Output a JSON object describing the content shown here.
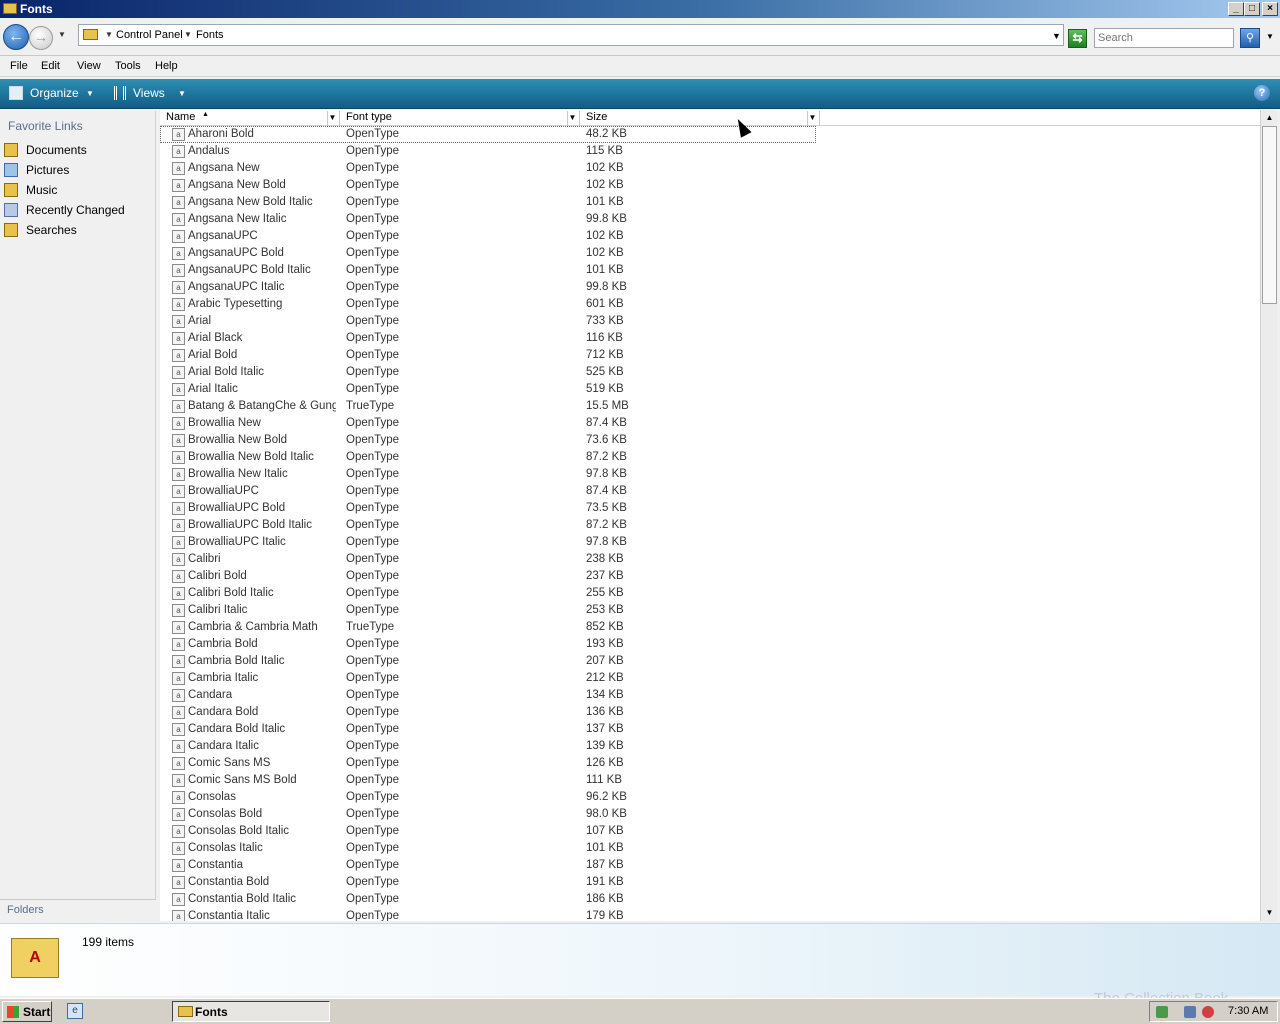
{
  "window": {
    "title": "Fonts"
  },
  "caption_buttons": {
    "minimize": "_",
    "maximize": "□",
    "close": "×"
  },
  "address": {
    "crumbs": [
      "Control Panel",
      "Fonts"
    ]
  },
  "search": {
    "placeholder": "Search"
  },
  "menu": [
    "File",
    "Edit",
    "View",
    "Tools",
    "Help"
  ],
  "commands": {
    "organize": "Organize",
    "views": "Views",
    "help": "?"
  },
  "nav": {
    "title": "Favorite Links",
    "links": [
      "Documents",
      "Pictures",
      "Music",
      "Recently Changed",
      "Searches"
    ],
    "folders_label": "Folders"
  },
  "columns": {
    "name": "Name",
    "type": "Font type",
    "size": "Size"
  },
  "rows": [
    {
      "name": "Aharoni Bold",
      "type": "OpenType",
      "size": "48.2 KB"
    },
    {
      "name": "Andalus",
      "type": "OpenType",
      "size": "115 KB"
    },
    {
      "name": "Angsana New",
      "type": "OpenType",
      "size": "102 KB"
    },
    {
      "name": "Angsana New Bold",
      "type": "OpenType",
      "size": "102 KB"
    },
    {
      "name": "Angsana New Bold Italic",
      "type": "OpenType",
      "size": "101 KB"
    },
    {
      "name": "Angsana New Italic",
      "type": "OpenType",
      "size": "99.8 KB"
    },
    {
      "name": "AngsanaUPC",
      "type": "OpenType",
      "size": "102 KB"
    },
    {
      "name": "AngsanaUPC Bold",
      "type": "OpenType",
      "size": "102 KB"
    },
    {
      "name": "AngsanaUPC Bold Italic",
      "type": "OpenType",
      "size": "101 KB"
    },
    {
      "name": "AngsanaUPC Italic",
      "type": "OpenType",
      "size": "99.8 KB"
    },
    {
      "name": "Arabic Typesetting",
      "type": "OpenType",
      "size": "601 KB"
    },
    {
      "name": "Arial",
      "type": "OpenType",
      "size": "733 KB"
    },
    {
      "name": "Arial Black",
      "type": "OpenType",
      "size": "116 KB"
    },
    {
      "name": "Arial Bold",
      "type": "OpenType",
      "size": "712 KB"
    },
    {
      "name": "Arial Bold Italic",
      "type": "OpenType",
      "size": "525 KB"
    },
    {
      "name": "Arial Italic",
      "type": "OpenType",
      "size": "519 KB"
    },
    {
      "name": "Batang & BatangChe & Gung...",
      "type": "TrueType",
      "size": "15.5 MB"
    },
    {
      "name": "Browallia New",
      "type": "OpenType",
      "size": "87.4 KB"
    },
    {
      "name": "Browallia New Bold",
      "type": "OpenType",
      "size": "73.6 KB"
    },
    {
      "name": "Browallia New Bold Italic",
      "type": "OpenType",
      "size": "87.2 KB"
    },
    {
      "name": "Browallia New Italic",
      "type": "OpenType",
      "size": "97.8 KB"
    },
    {
      "name": "BrowalliaUPC",
      "type": "OpenType",
      "size": "87.4 KB"
    },
    {
      "name": "BrowalliaUPC Bold",
      "type": "OpenType",
      "size": "73.5 KB"
    },
    {
      "name": "BrowalliaUPC Bold Italic",
      "type": "OpenType",
      "size": "87.2 KB"
    },
    {
      "name": "BrowalliaUPC Italic",
      "type": "OpenType",
      "size": "97.8 KB"
    },
    {
      "name": "Calibri",
      "type": "OpenType",
      "size": "238 KB"
    },
    {
      "name": "Calibri Bold",
      "type": "OpenType",
      "size": "237 KB"
    },
    {
      "name": "Calibri Bold Italic",
      "type": "OpenType",
      "size": "255 KB"
    },
    {
      "name": "Calibri Italic",
      "type": "OpenType",
      "size": "253 KB"
    },
    {
      "name": "Cambria & Cambria Math",
      "type": "TrueType",
      "size": "852 KB"
    },
    {
      "name": "Cambria Bold",
      "type": "OpenType",
      "size": "193 KB"
    },
    {
      "name": "Cambria Bold Italic",
      "type": "OpenType",
      "size": "207 KB"
    },
    {
      "name": "Cambria Italic",
      "type": "OpenType",
      "size": "212 KB"
    },
    {
      "name": "Candara",
      "type": "OpenType",
      "size": "134 KB"
    },
    {
      "name": "Candara Bold",
      "type": "OpenType",
      "size": "136 KB"
    },
    {
      "name": "Candara Bold Italic",
      "type": "OpenType",
      "size": "137 KB"
    },
    {
      "name": "Candara Italic",
      "type": "OpenType",
      "size": "139 KB"
    },
    {
      "name": "Comic Sans MS",
      "type": "OpenType",
      "size": "126 KB"
    },
    {
      "name": "Comic Sans MS Bold",
      "type": "OpenType",
      "size": "111 KB"
    },
    {
      "name": "Consolas",
      "type": "OpenType",
      "size": "96.2 KB"
    },
    {
      "name": "Consolas Bold",
      "type": "OpenType",
      "size": "98.0 KB"
    },
    {
      "name": "Consolas Bold Italic",
      "type": "OpenType",
      "size": "107 KB"
    },
    {
      "name": "Consolas Italic",
      "type": "OpenType",
      "size": "101 KB"
    },
    {
      "name": "Constantia",
      "type": "OpenType",
      "size": "187 KB"
    },
    {
      "name": "Constantia Bold",
      "type": "OpenType",
      "size": "191 KB"
    },
    {
      "name": "Constantia Bold Italic",
      "type": "OpenType",
      "size": "186 KB"
    },
    {
      "name": "Constantia Italic",
      "type": "OpenType",
      "size": "179 KB"
    }
  ],
  "details": {
    "count": "199 items"
  },
  "watermark": "The Collection Book",
  "taskbar": {
    "start": "Start",
    "task": "Fonts",
    "clock": "7:30 AM"
  },
  "colors": {
    "cmdbar": "#1a74a0",
    "title_gradient_start": "#0a246a",
    "nav_title": "#5a6e8a"
  }
}
